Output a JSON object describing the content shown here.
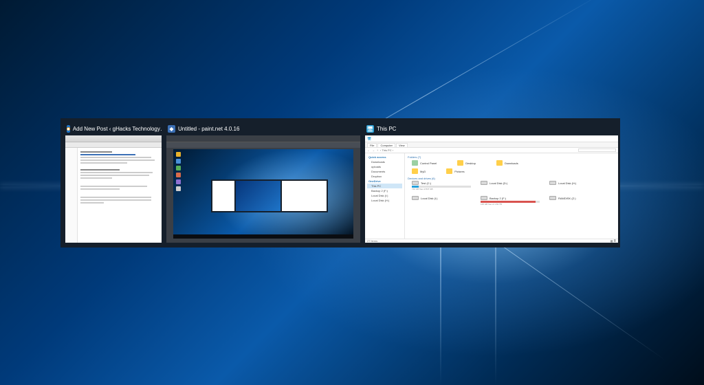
{
  "tasks": [
    {
      "title": "Add New Post ‹ gHacks Technology…",
      "icon": "firefox-icon",
      "icon_color": "#1e74c8"
    },
    {
      "title": "Untitled - paint.net 4.0.16",
      "icon": "paintnet-icon",
      "icon_color": "#3b6fb5"
    },
    {
      "title": "This PC",
      "icon": "thispc-icon",
      "icon_color": "#2a9fd6"
    }
  ],
  "explorer": {
    "ribbon_tabs": [
      "File",
      "Computer",
      "View"
    ],
    "breadcrumb": "› This PC ›",
    "search_placeholder": "Search Th…",
    "quick_access": "Quick access",
    "nav": [
      "Downloads",
      "uploads",
      "Documents",
      "Dropbox",
      "OneDrive",
      "This PC",
      "Backup 2 (F:)",
      "Local Disk (I:)",
      "Local Disk (H:)"
    ],
    "nav_selected": "This PC",
    "sections": {
      "folders": "Folders (7)",
      "drives": "Devices and drives (6)"
    },
    "folders": [
      "Control Panel",
      "Desktop",
      "Downloads",
      "MyD",
      "Pictures"
    ],
    "drives": [
      {
        "name": "Test (C:)",
        "sub": "746 GB free of 847 GB",
        "pct": 12,
        "warn": false
      },
      {
        "name": "Local Disk (D:)",
        "sub": "",
        "pct": 0,
        "warn": false
      },
      {
        "name": "Local Disk (H:)",
        "sub": "",
        "pct": 0,
        "warn": false
      },
      {
        "name": "Local Disk (I:)",
        "sub": "",
        "pct": 0,
        "warn": false
      },
      {
        "name": "Backup 2 (F:)",
        "sub": "125 GB free of 1.81 TB",
        "pct": 93,
        "warn": true
      },
      {
        "name": "RAMDISK (Z:)",
        "sub": "",
        "pct": 0,
        "warn": false
      }
    ],
    "status_items": "27 items"
  }
}
